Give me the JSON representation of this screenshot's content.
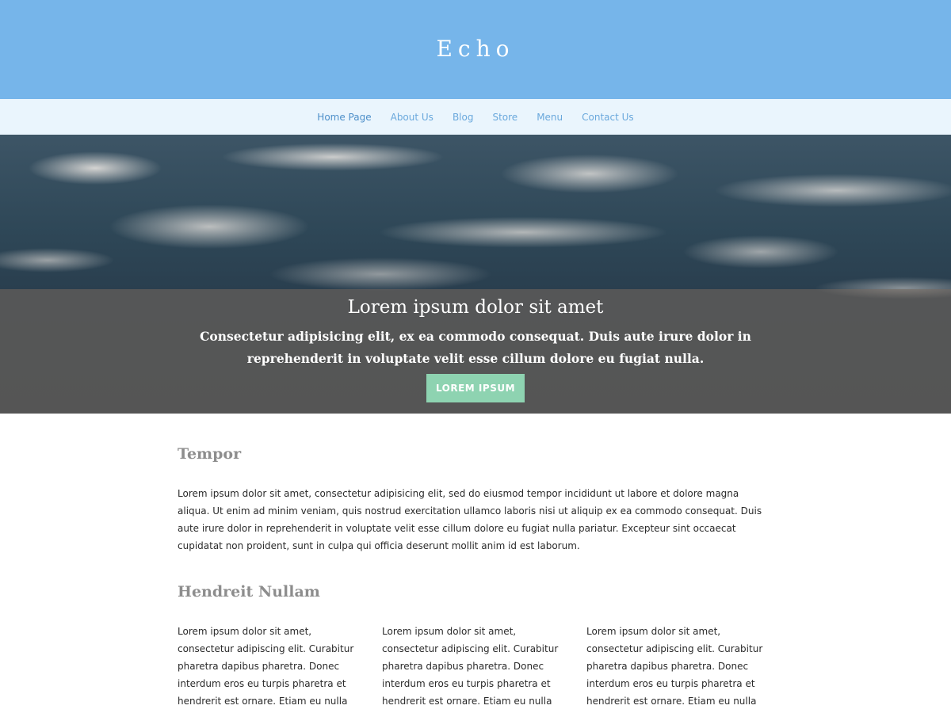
{
  "site": {
    "title": "Echo"
  },
  "nav": {
    "items": [
      {
        "label": "Home Page"
      },
      {
        "label": "About Us"
      },
      {
        "label": "Blog"
      },
      {
        "label": "Store"
      },
      {
        "label": "Menu"
      },
      {
        "label": "Contact Us"
      }
    ]
  },
  "hero": {
    "title": "Lorem ipsum dolor sit amet",
    "subtitle": "Consectetur adipisicing elit, ex ea commodo consequat. Duis aute irure dolor in reprehenderit in voluptate velit esse cillum dolore eu fugiat nulla.",
    "button_label": "LOREM IPSUM"
  },
  "sections": {
    "tempor": {
      "title": "Tempor",
      "body": "Lorem ipsum dolor sit amet, consectetur adipisicing elit, sed do eiusmod tempor incididunt ut labore et dolore magna aliqua. Ut enim ad minim veniam, quis nostrud exercitation ullamco laboris nisi ut aliquip ex ea commodo consequat. Duis aute irure dolor in reprehenderit in voluptate velit esse cillum dolore eu fugiat nulla pariatur. Excepteur sint occaecat cupidatat non proident, sunt in culpa qui officia deserunt mollit anim id est laborum."
    },
    "hendreit": {
      "title": "Hendreit Nullam",
      "columns": [
        "Lorem ipsum dolor sit amet, consectetur adipiscing elit. Curabitur pharetra dapibus pharetra. Donec interdum eros eu turpis pharetra et hendrerit est ornare. Etiam eu nulla sapien. Nullam ultricies posuere nunc,",
        "Lorem ipsum dolor sit amet, consectetur adipiscing elit. Curabitur pharetra dapibus pharetra. Donec interdum eros eu turpis pharetra et hendrerit est ornare. Etiam eu nulla sapien. Nullam ultricies posuere nunc,",
        "Lorem ipsum dolor sit amet, consectetur adipiscing elit. Curabitur pharetra dapibus pharetra. Donec interdum eros eu turpis pharetra et hendrerit est ornare. Etiam eu nulla sapien. Nullam ultricies posuere nunc,"
      ]
    }
  },
  "colors": {
    "header_bg": "#76b5ea",
    "nav_bg": "#eaf5fd",
    "nav_link": "#6aa8dc",
    "button_bg": "#8ed3b1",
    "heading_gray": "#8d8d8d"
  }
}
